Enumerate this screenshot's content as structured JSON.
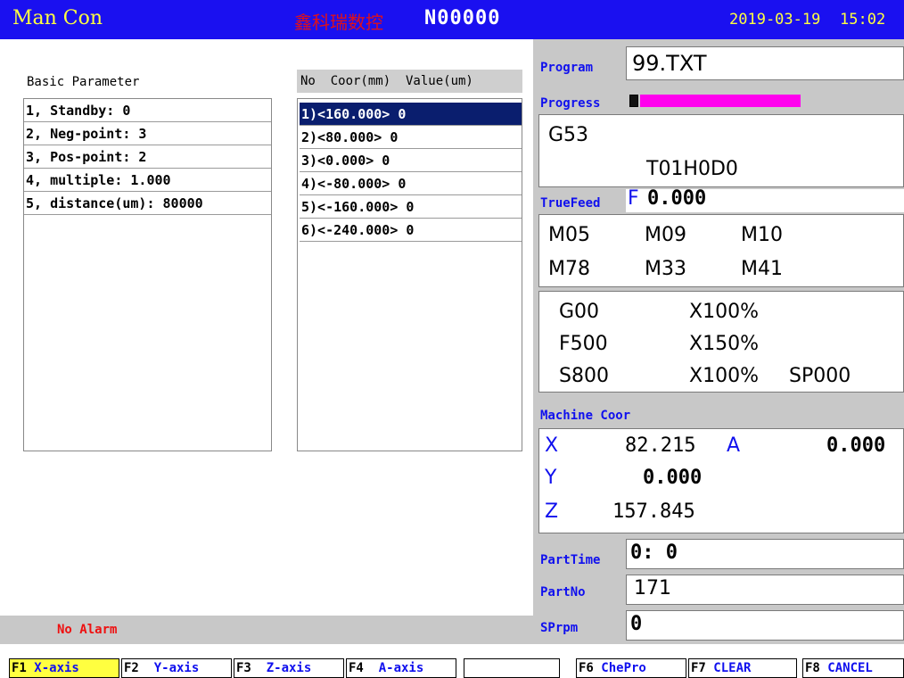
{
  "titlebar": {
    "mode": "Man Con",
    "brand": "鑫科瑞数控",
    "program_no": "N00000",
    "date": "2019-03-19",
    "time": "15:02"
  },
  "basic_params": {
    "title": "Basic Parameter",
    "rows": [
      "1, Standby: 0",
      "2, Neg-point: 3",
      "3, Pos-point: 2",
      "4, multiple: 1.000",
      "5, distance(um): 80000"
    ]
  },
  "comp_values": {
    "header": "No  Coor(mm)  Value(um)",
    "rows": [
      "1)<160.000> 0",
      "2)<80.000> 0",
      "3)<0.000> 0",
      "4)<-80.000> 0",
      "5)<-160.000> 0",
      "6)<-240.000> 0"
    ],
    "selected_index": 0
  },
  "alarm": {
    "text": "No Alarm"
  },
  "status": {
    "program_label": "Program",
    "program_value": "99.TXT",
    "progress_label": "Progress",
    "progress_fraction": 0.02,
    "progress_color": "#ff00ee",
    "gcode_line1": "G53",
    "gcode_line2": "T01H0D0",
    "truefeed_label": "TrueFeed",
    "truefeed_prefix": "F",
    "truefeed_value": "0.000",
    "mcodes_row1": [
      "M05",
      "M09",
      "M10"
    ],
    "mcodes_row2": [
      "M78",
      "M33",
      "M41"
    ],
    "modal": [
      [
        "G00",
        "X100%",
        ""
      ],
      [
        "F500",
        "X150%",
        ""
      ],
      [
        "S800",
        "X100%",
        "SP000"
      ]
    ],
    "machine_coor_label": "Machine Coor",
    "coords": {
      "x_label": "X",
      "x_value": "82.215",
      "a_label": "A",
      "a_value": "0.000",
      "y_label": "Y",
      "y_value": "0.000",
      "z_label": "Z",
      "z_value": "157.845"
    },
    "parttime_label": "PartTime",
    "parttime_value": "0: 0",
    "partno_label": "PartNo",
    "partno_value": "171",
    "sprpm_label": "SPrpm",
    "sprpm_value": "0"
  },
  "fkeys": [
    {
      "num": "F1",
      "name": " X-axis",
      "active": true
    },
    {
      "num": "F2",
      "name": "  Y-axis",
      "active": false
    },
    {
      "num": "F3",
      "name": "  Z-axis",
      "active": false
    },
    {
      "num": "F4",
      "name": "  A-axis",
      "active": false
    },
    {
      "num": "",
      "name": "",
      "active": false
    },
    {
      "num": "F6",
      "name": " ChePro",
      "active": false
    },
    {
      "num": "F7",
      "name": " CLEAR",
      "active": false
    },
    {
      "num": "F8",
      "name": " CANCEL",
      "active": false
    }
  ],
  "colors": {
    "title_bg": "#1a10f0",
    "title_fg": "#ffff40",
    "brand": "#e0101a",
    "selected_row": "#0a1e6e",
    "label_blue": "#1010ee",
    "alarm_red": "#ee1010"
  }
}
